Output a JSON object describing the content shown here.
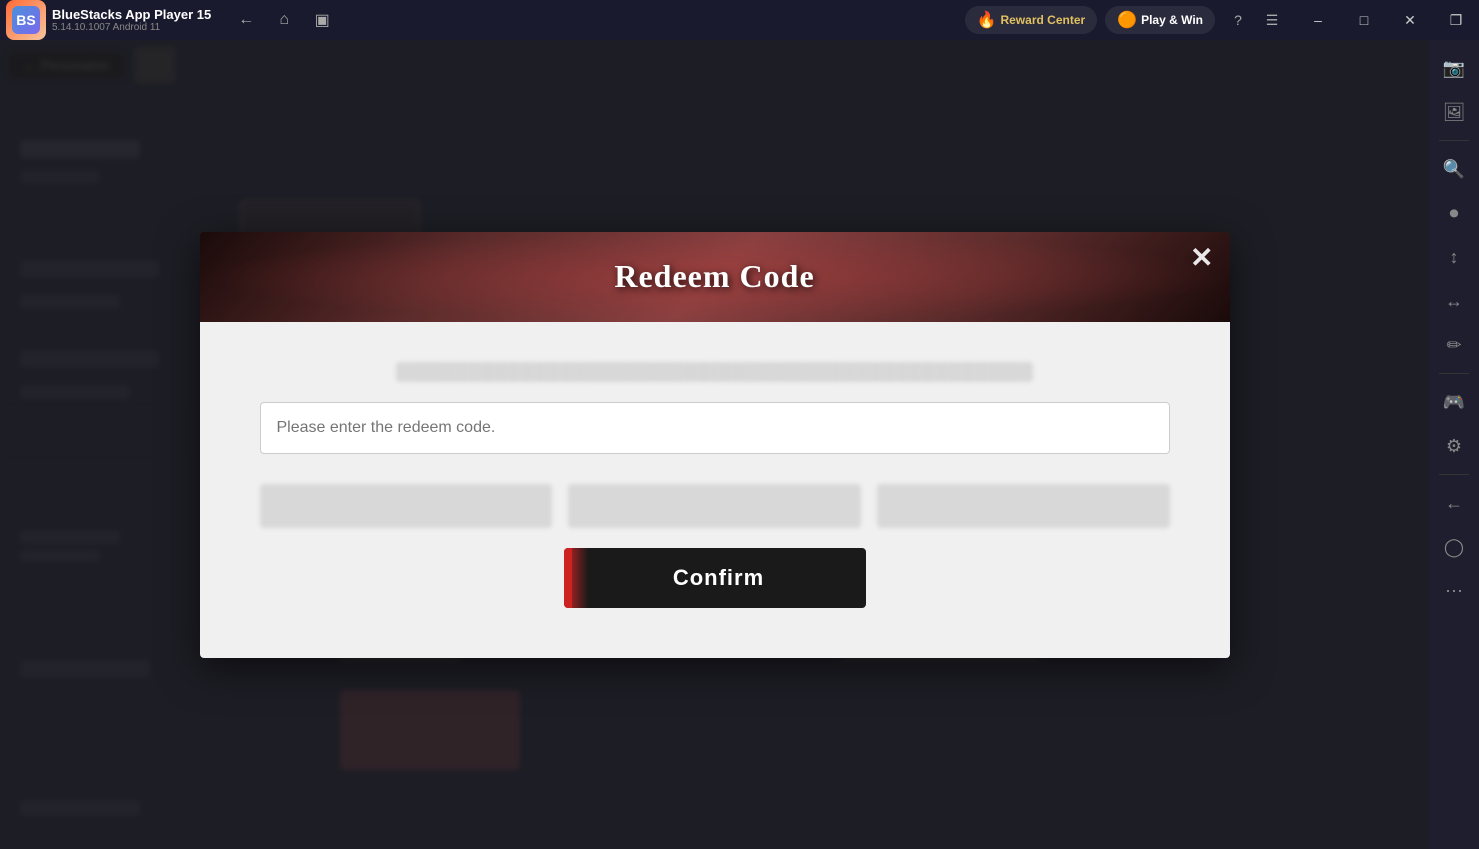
{
  "titlebar": {
    "app_title": "BlueStacks App Player 15",
    "app_version": "5.14.10.1007  Android 11",
    "reward_center_label": "Reward Center",
    "play_win_label": "Play & Win",
    "nav": {
      "back": "←",
      "home": "⌂",
      "tabs": "▣"
    },
    "window_buttons": {
      "minimize": "─",
      "maximize": "□",
      "close": "✕",
      "restore": "❐"
    }
  },
  "modal": {
    "title": "Redeem Code",
    "close_label": "✕",
    "input_placeholder": "Please enter the redeem code.",
    "confirm_label": "Confirm"
  },
  "sidebar": {
    "icons": [
      "📸",
      "🖼",
      "🔍",
      "⏺",
      "↕",
      "↔",
      "✏",
      "🎮",
      "⚙",
      "←",
      "◯",
      "⋯"
    ]
  }
}
